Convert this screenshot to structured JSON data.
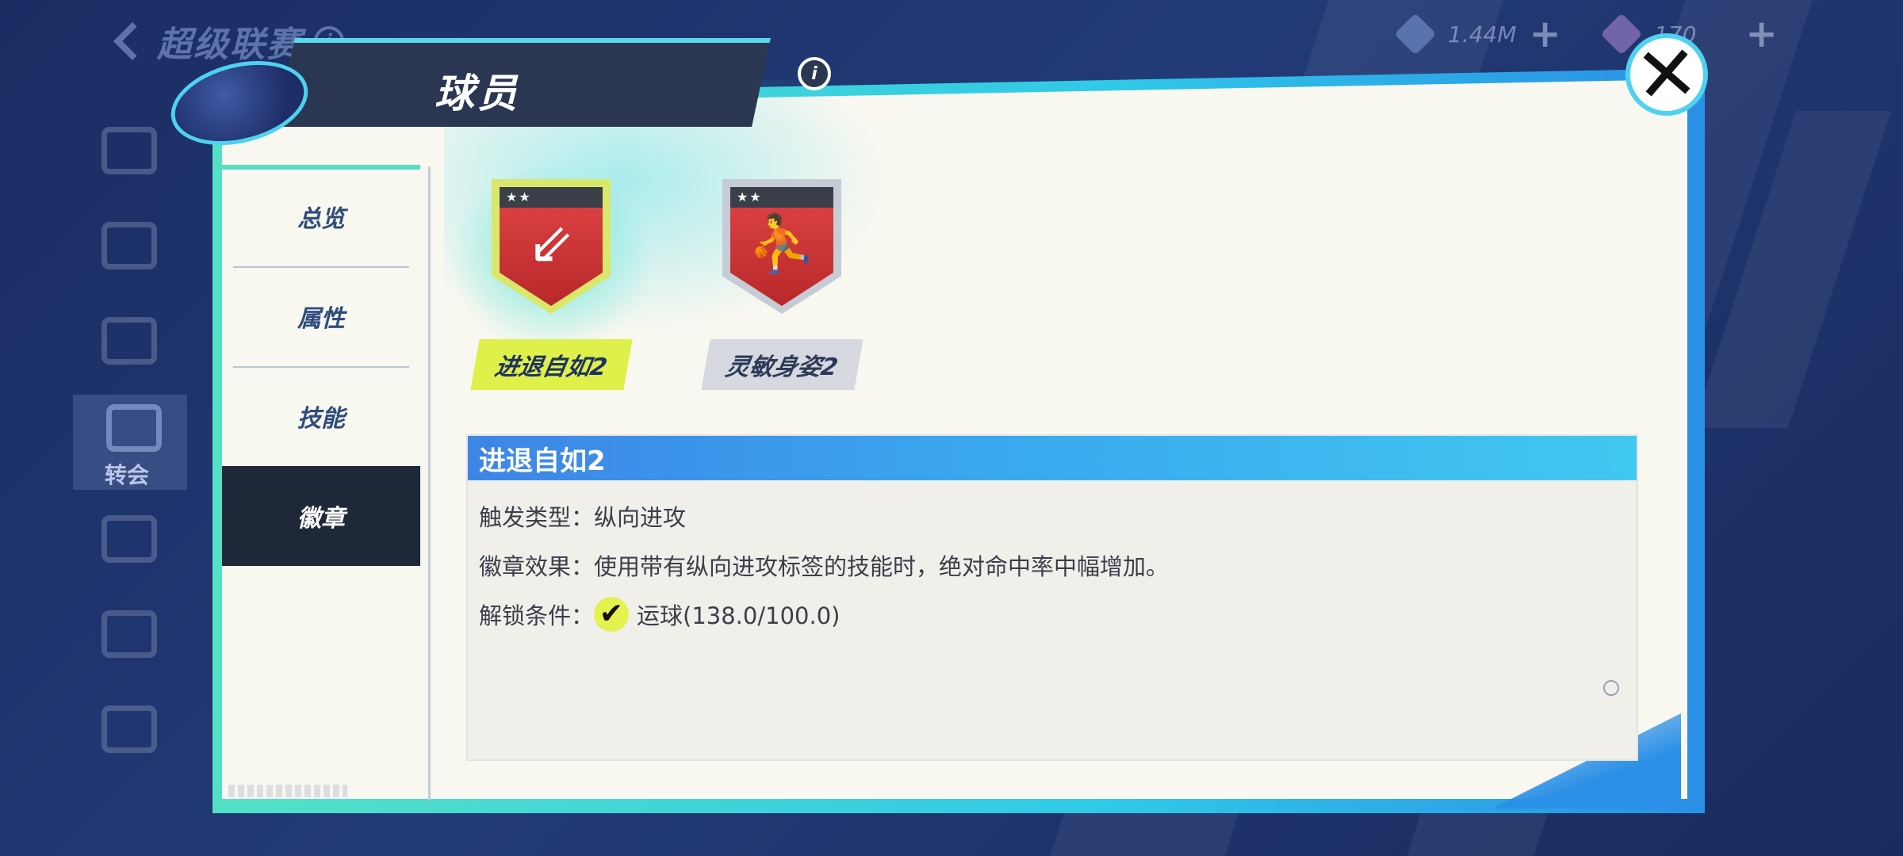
{
  "topbar": {
    "league_title": "超级联赛",
    "info_label": "i",
    "currency_1": {
      "value": "1.44M",
      "icon": "diamond-currency-icon"
    },
    "currency_2": {
      "value": "170",
      "icon": "gold-currency-icon"
    },
    "plus_label": "+"
  },
  "sidenav": {
    "active_label": "转会"
  },
  "modal": {
    "title": "球员",
    "info_label": "i",
    "close_label": "✕"
  },
  "tabs": [
    {
      "label": "总览"
    },
    {
      "label": "属性"
    },
    {
      "label": "技能"
    },
    {
      "label": "徽章",
      "active": true
    }
  ],
  "badges": [
    {
      "name": "进退自如2",
      "stars": "★★",
      "code": "0401",
      "selected": true,
      "icon": "shoe-arrow-badge-icon"
    },
    {
      "name": "灵敏身姿2",
      "stars": "★★",
      "code": "0401",
      "selected": false,
      "icon": "dribbler-badge-icon"
    }
  ],
  "detail": {
    "title": "进退自如2",
    "rows": [
      {
        "label": "触发类型：",
        "value": "纵向进攻"
      },
      {
        "label": "徽章效果：",
        "value": "使用带有纵向进攻标签的技能时，绝对命中率中幅增加。"
      },
      {
        "label": "解锁条件：",
        "value": "运球(138.0/100.0)",
        "check": "✔"
      }
    ]
  },
  "colors": {
    "accent_teal": "#53e1c5",
    "accent_blue": "#2a8fe6",
    "badge_red": "#e04444",
    "selected_label": "#dff04a",
    "tab_active_bg": "#1f2838"
  }
}
